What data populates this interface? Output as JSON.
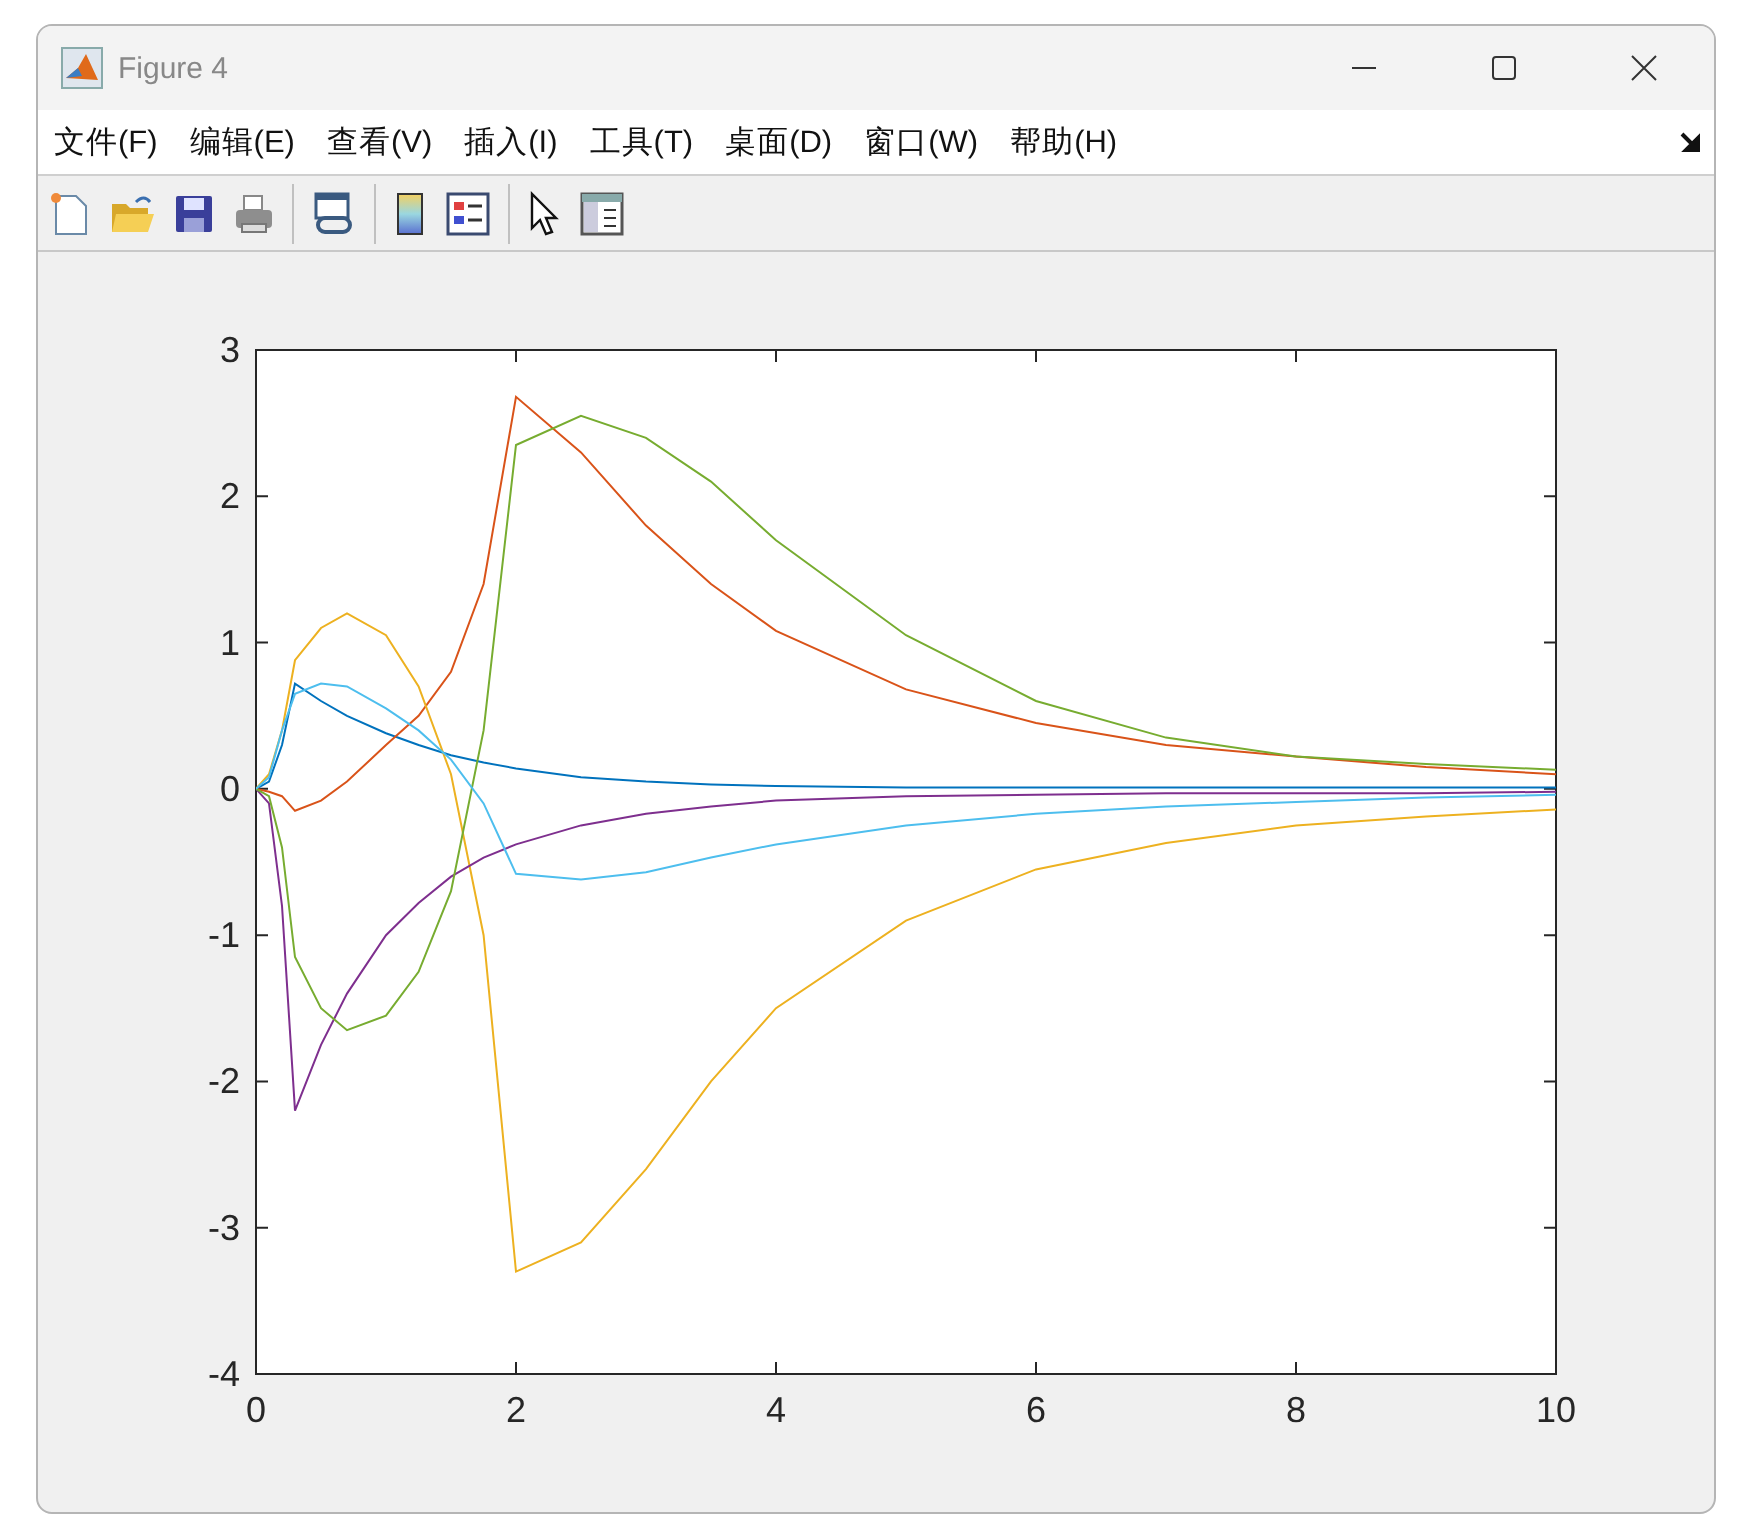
{
  "window": {
    "title": "Figure 4"
  },
  "menu": [
    "文件(F)",
    "编辑(E)",
    "查看(V)",
    "插入(I)",
    "工具(T)",
    "桌面(D)",
    "窗口(W)",
    "帮助(H)"
  ],
  "figure": {
    "chart_data": {
      "type": "line",
      "x": [
        0,
        0.1,
        0.2,
        0.3,
        0.5,
        0.7,
        1,
        1.25,
        1.5,
        1.75,
        2,
        2.5,
        3,
        3.5,
        4,
        5,
        6,
        7,
        8,
        9,
        10
      ],
      "xlim": [
        0,
        10
      ],
      "ylim": [
        -4,
        3
      ],
      "xticks": [
        0,
        2,
        4,
        6,
        8,
        10
      ],
      "yticks": [
        -4,
        -3,
        -2,
        -1,
        0,
        1,
        2,
        3
      ],
      "series": [
        {
          "color": "#0072bd",
          "values": [
            0,
            0.05,
            0.3,
            0.72,
            0.6,
            0.5,
            0.38,
            0.3,
            0.23,
            0.18,
            0.14,
            0.08,
            0.05,
            0.03,
            0.02,
            0.01,
            0.01,
            0.01,
            0.01,
            0.01,
            0.01
          ]
        },
        {
          "color": "#d95319",
          "values": [
            0,
            -0.02,
            -0.05,
            -0.15,
            -0.08,
            0.05,
            0.3,
            0.5,
            0.8,
            1.4,
            2.68,
            2.3,
            1.8,
            1.4,
            1.08,
            0.68,
            0.45,
            0.3,
            0.22,
            0.15,
            0.1
          ]
        },
        {
          "color": "#edb120",
          "values": [
            0,
            0.1,
            0.4,
            0.88,
            1.1,
            1.2,
            1.05,
            0.7,
            0.1,
            -1.0,
            -3.3,
            -3.1,
            -2.6,
            -2.0,
            -1.5,
            -0.9,
            -0.55,
            -0.37,
            -0.25,
            -0.19,
            -0.14
          ]
        },
        {
          "color": "#7e2f8e",
          "values": [
            0,
            -0.1,
            -0.8,
            -2.2,
            -1.75,
            -1.4,
            -1.0,
            -0.78,
            -0.6,
            -0.47,
            -0.38,
            -0.25,
            -0.17,
            -0.12,
            -0.08,
            -0.05,
            -0.04,
            -0.03,
            -0.03,
            -0.03,
            -0.02
          ]
        },
        {
          "color": "#77ac30",
          "values": [
            0,
            -0.05,
            -0.4,
            -1.15,
            -1.5,
            -1.65,
            -1.55,
            -1.25,
            -0.7,
            0.4,
            2.35,
            2.55,
            2.4,
            2.1,
            1.7,
            1.05,
            0.6,
            0.35,
            0.22,
            0.17,
            0.13
          ]
        },
        {
          "color": "#4dbeee",
          "values": [
            0,
            0.08,
            0.4,
            0.65,
            0.72,
            0.7,
            0.55,
            0.4,
            0.2,
            -0.1,
            -0.58,
            -0.62,
            -0.57,
            -0.47,
            -0.38,
            -0.25,
            -0.17,
            -0.12,
            -0.09,
            -0.06,
            -0.04
          ]
        }
      ]
    }
  }
}
